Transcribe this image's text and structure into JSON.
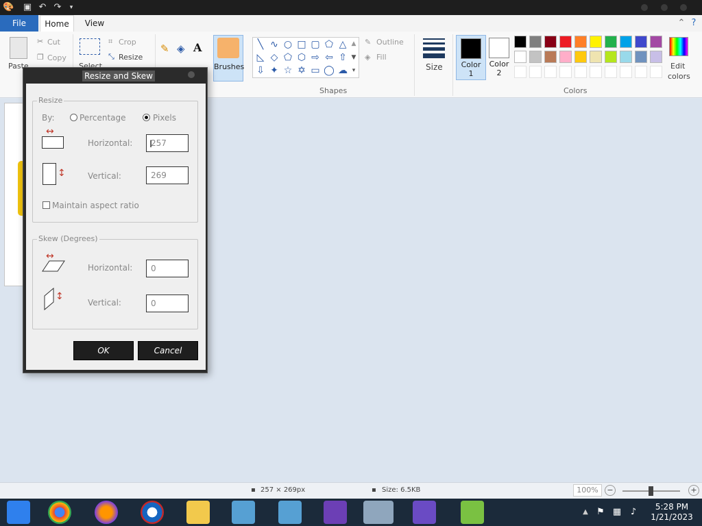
{
  "tabs": {
    "file": "File",
    "home": "Home",
    "view": "View"
  },
  "clipboard": {
    "paste": "Paste",
    "cut": "Cut",
    "copy": "Copy"
  },
  "image": {
    "select": "Select",
    "crop": "Crop",
    "resize": "Resize"
  },
  "brushes": {
    "label": "Brushes"
  },
  "shapes": {
    "label": "Shapes",
    "outline": "Outline",
    "fill": "Fill"
  },
  "size": {
    "label": "Size"
  },
  "colors": {
    "label": "Colors",
    "color1_line1": "Color",
    "color1_line2": "1",
    "color2_line1": "Color",
    "color2_line2": "2",
    "edit_line1": "Edit",
    "edit_line2": "colors",
    "color1_value": "#000000",
    "color2_value": "#ffffff",
    "palette_row1": [
      "#000000",
      "#7f7f7f",
      "#880015",
      "#ed1c24",
      "#ff7f27",
      "#fff200",
      "#22b14c",
      "#00a2e8",
      "#3f48cc",
      "#a349a4"
    ],
    "palette_row2": [
      "#ffffff",
      "#c3c3c3",
      "#b97a57",
      "#ffaec9",
      "#ffc90e",
      "#efe4b0",
      "#b5e61d",
      "#99d9ea",
      "#7092be",
      "#c8bfe7"
    ]
  },
  "dialog": {
    "title": "Resize and Skew",
    "resize_group": "Resize",
    "by_label": "By:",
    "percentage": "Percentage",
    "pixels": "Pixels",
    "horizontal_label": "Horizontal:",
    "vertical_label": "Vertical:",
    "resize_horizontal": "257",
    "resize_vertical": "269",
    "maintain_aspect": "Maintain aspect ratio",
    "skew_group": "Skew (Degrees)",
    "skew_horizontal": "0",
    "skew_vertical": "0",
    "ok": "OK",
    "cancel": "Cancel"
  },
  "status": {
    "dimensions": "257 × 269px",
    "size": "Size: 6.5KB",
    "zoom": "100%",
    "zoom_level": 100
  },
  "clock": {
    "time": "5:28 PM",
    "date": "1/21/2023"
  }
}
